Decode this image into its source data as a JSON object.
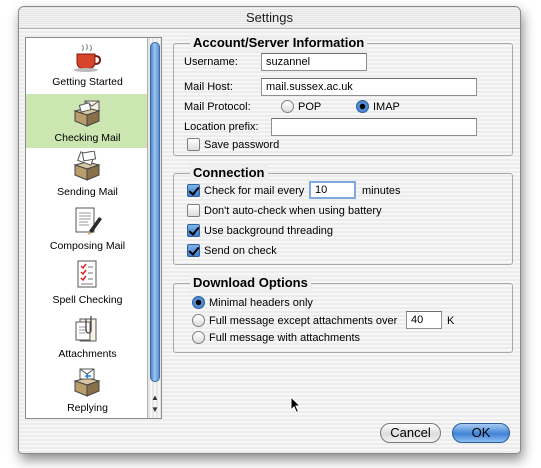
{
  "window": {
    "title": "Settings"
  },
  "sidebar": {
    "items": [
      {
        "label": "Getting Started",
        "icon": "coffee-cup-icon"
      },
      {
        "label": "Checking Mail",
        "icon": "mailbox-icon",
        "selected": true
      },
      {
        "label": "Sending Mail",
        "icon": "outgoing-mail-icon"
      },
      {
        "label": "Composing Mail",
        "icon": "compose-pen-icon"
      },
      {
        "label": "Spell Checking",
        "icon": "checklist-icon"
      },
      {
        "label": "Attachments",
        "icon": "paperclip-document-icon"
      },
      {
        "label": "Replying",
        "icon": "reply-mail-icon"
      }
    ]
  },
  "account": {
    "title": "Account/Server Information",
    "username_label": "Username:",
    "username_value": "suzannel",
    "mailhost_label": "Mail Host:",
    "mailhost_value": "mail.sussex.ac.uk",
    "protocol_label": "Mail Protocol:",
    "protocol_pop": "POP",
    "protocol_imap": "IMAP",
    "protocol_selected": "IMAP",
    "location_label": "Location prefix:",
    "location_value": "",
    "save_password_label": "Save password",
    "save_password_checked": false
  },
  "connection": {
    "title": "Connection",
    "check_every_label": "Check for mail every",
    "check_every_value": "10",
    "check_every_unit": "minutes",
    "check_every_checked": true,
    "battery_label": "Don't auto-check when using battery",
    "battery_checked": false,
    "threading_label": "Use background threading",
    "threading_checked": true,
    "send_on_check_label": "Send on check",
    "send_on_check_checked": true
  },
  "download": {
    "title": "Download Options",
    "option_minimal": "Minimal headers only",
    "option_except": "Full message except attachments over",
    "except_size_value": "40",
    "except_size_unit": "K",
    "option_full": "Full message with attachments",
    "selected": "Minimal headers only"
  },
  "buttons": {
    "cancel": "Cancel",
    "ok": "OK"
  },
  "colors": {
    "selection": "#cbe6b0",
    "accent": "#3f83d6"
  }
}
